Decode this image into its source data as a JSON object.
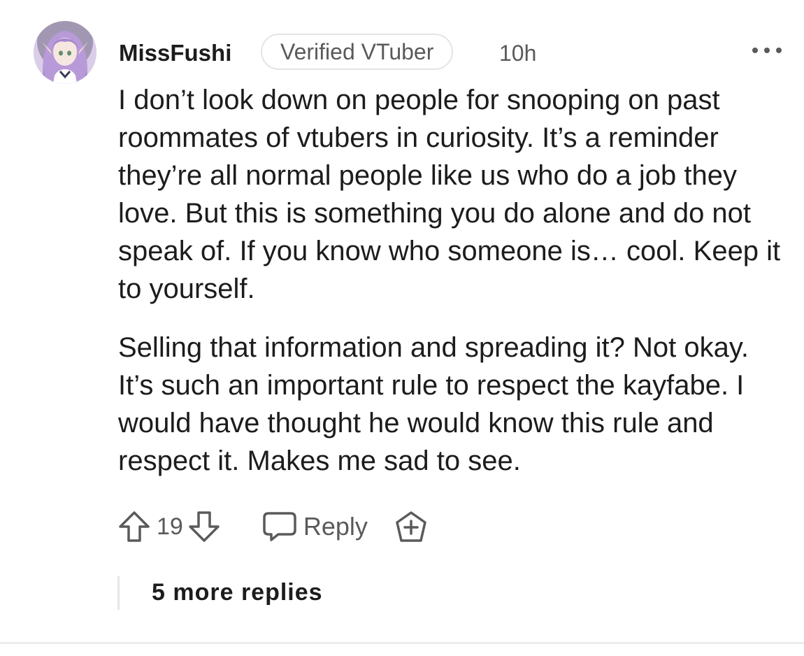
{
  "comment": {
    "username": "MissFushi",
    "flair": "Verified VTuber",
    "timestamp": "10h",
    "paragraphs": [
      "I don’t look down on people for snooping on past roommates of vtubers in curiosity. It’s a reminder they’re all normal people like us who do a job they love. But this is something you do alone and do not speak of. If you know who someone is… cool. Keep it to yourself.",
      "Selling that information and spreading it? Not okay. It’s such an important rule to respect the kayfabe. I would have thought he would know this rule and respect it. Makes me sad to see."
    ],
    "votes": "19",
    "reply_label": "Reply",
    "more_replies": "5 more replies"
  },
  "icons": {
    "avatar": "avatar-anime-character",
    "more": "more-horizontal-icon",
    "upvote": "upvote-arrow-icon",
    "downvote": "downvote-arrow-icon",
    "reply": "speech-bubble-icon",
    "award": "award-plus-icon"
  },
  "colors": {
    "text": "#1c1c1c",
    "meta": "#5a5a5a",
    "flair_border": "#e4e4e4",
    "avatar_hair": "#b89ad8"
  }
}
